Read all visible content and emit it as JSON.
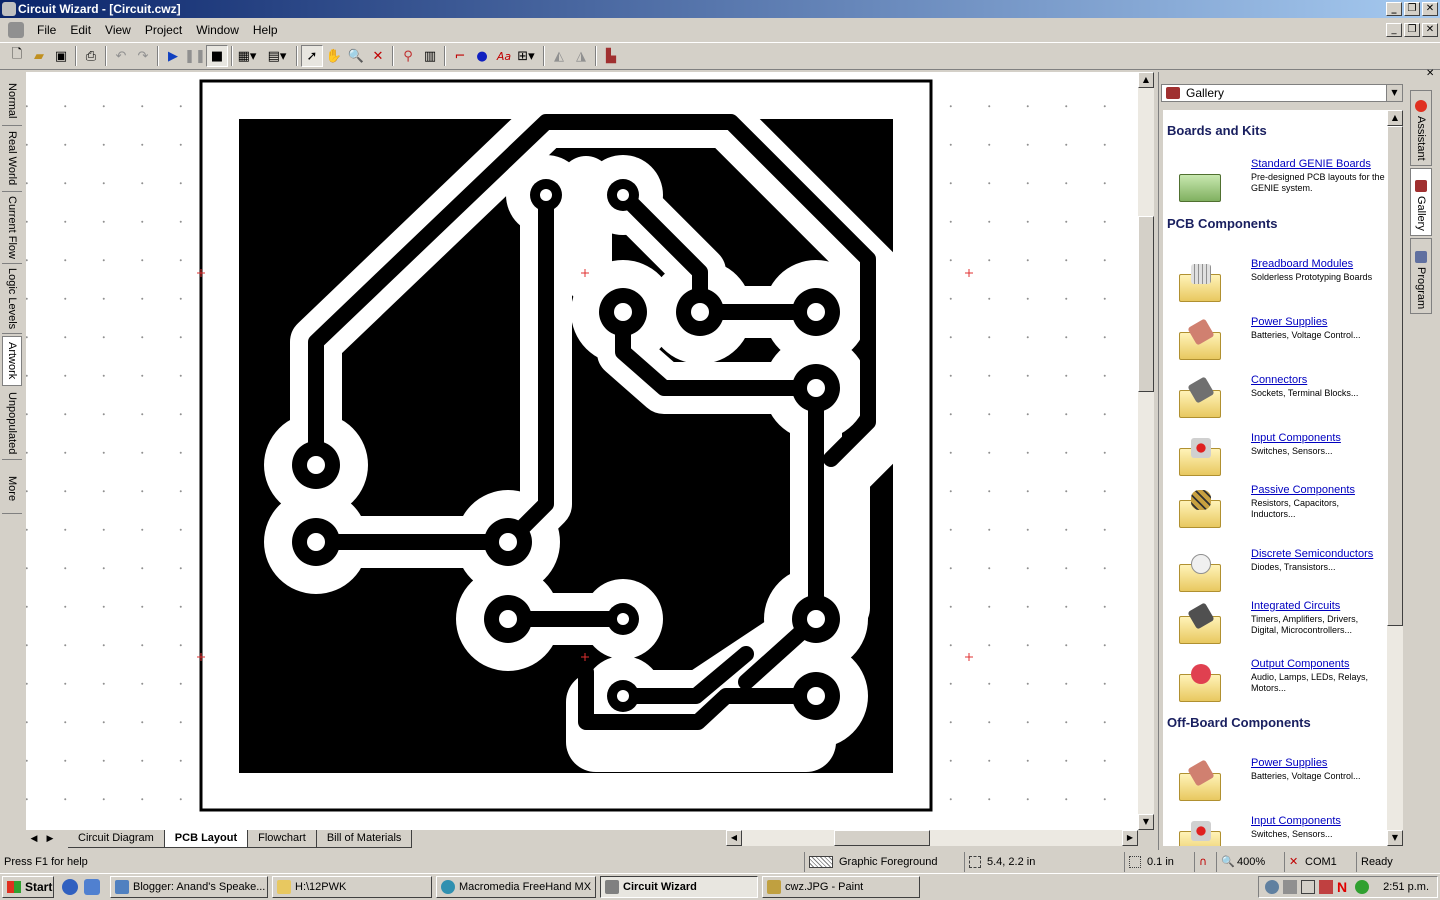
{
  "window": {
    "title": "Circuit Wizard - [Circuit.cwz]"
  },
  "menu": [
    "File",
    "Edit",
    "View",
    "Project",
    "Window",
    "Help"
  ],
  "left_tabs": [
    "Normal",
    "Real World",
    "Current Flow",
    "Logic Levels",
    "Artwork",
    "Unpopulated",
    "More"
  ],
  "left_tabs_active": "Artwork",
  "sheet_tabs": [
    "Circuit Diagram",
    "PCB Layout",
    "Flowchart",
    "Bill of Materials"
  ],
  "sheet_tabs_active": "PCB Layout",
  "gallery": {
    "selector": "Gallery",
    "sections": [
      {
        "heading": "Boards and Kits",
        "items": [
          {
            "title": "Standard GENIE Boards",
            "desc": "Pre-designed PCB layouts for the GENIE system.",
            "icon": "genie-board-icon"
          }
        ]
      },
      {
        "heading": "PCB Components",
        "items": [
          {
            "title": "Breadboard Modules",
            "desc": "Solderless Prototyping Boards",
            "icon": "breadboard-icon"
          },
          {
            "title": "Power Supplies",
            "desc": "Batteries, Voltage Control...",
            "icon": "battery-icon"
          },
          {
            "title": "Connectors",
            "desc": "Sockets, Terminal Blocks...",
            "icon": "connector-icon"
          },
          {
            "title": "Input Components",
            "desc": "Switches, Sensors...",
            "icon": "switch-icon"
          },
          {
            "title": "Passive Components",
            "desc": "Resistors, Capacitors, Inductors...",
            "icon": "resistor-icon"
          },
          {
            "title": "Discrete Semiconductors",
            "desc": "Diodes, Transistors...",
            "icon": "diode-icon"
          },
          {
            "title": "Integrated Circuits",
            "desc": "Timers, Amplifiers, Drivers, Digital, Microcontrollers...",
            "icon": "ic-chip-icon"
          },
          {
            "title": "Output Components",
            "desc": "Audio, Lamps, LEDs, Relays, Motors...",
            "icon": "led-icon"
          }
        ]
      },
      {
        "heading": "Off-Board Components",
        "items": [
          {
            "title": "Power Supplies",
            "desc": "Batteries, Voltage Control...",
            "icon": "battery-icon"
          },
          {
            "title": "Input Components",
            "desc": "Switches, Sensors...",
            "icon": "switch-icon"
          }
        ]
      }
    ]
  },
  "right_tabs": [
    "Assistant",
    "Gallery",
    "Program"
  ],
  "right_tabs_active": "Gallery",
  "status": {
    "help": "Press F1 for help",
    "layer": "Graphic Foreground",
    "coords": "5.4, 2.2 in",
    "grid": "0.1 in",
    "zoom": "400%",
    "port": "COM1",
    "state": "Ready"
  },
  "taskbar": {
    "start": "Start",
    "tasks": [
      {
        "label": "Blogger: Anand's Speake...",
        "icon": "browser-icon",
        "active": false
      },
      {
        "label": "H:\\12PWK",
        "icon": "folder-icon",
        "active": false
      },
      {
        "label": "Macromedia FreeHand MX",
        "icon": "freehand-icon",
        "active": false
      },
      {
        "label": "Circuit Wizard",
        "icon": "circuit-wizard-icon",
        "active": true
      },
      {
        "label": "cwz.JPG - Paint",
        "icon": "paint-icon",
        "active": false
      }
    ],
    "clock": "2:51 p.m."
  },
  "colors": {
    "titlebar": "#0a246a",
    "link": "#0000c0",
    "heading": "#1a2060",
    "pcb_copper": "#000000"
  }
}
